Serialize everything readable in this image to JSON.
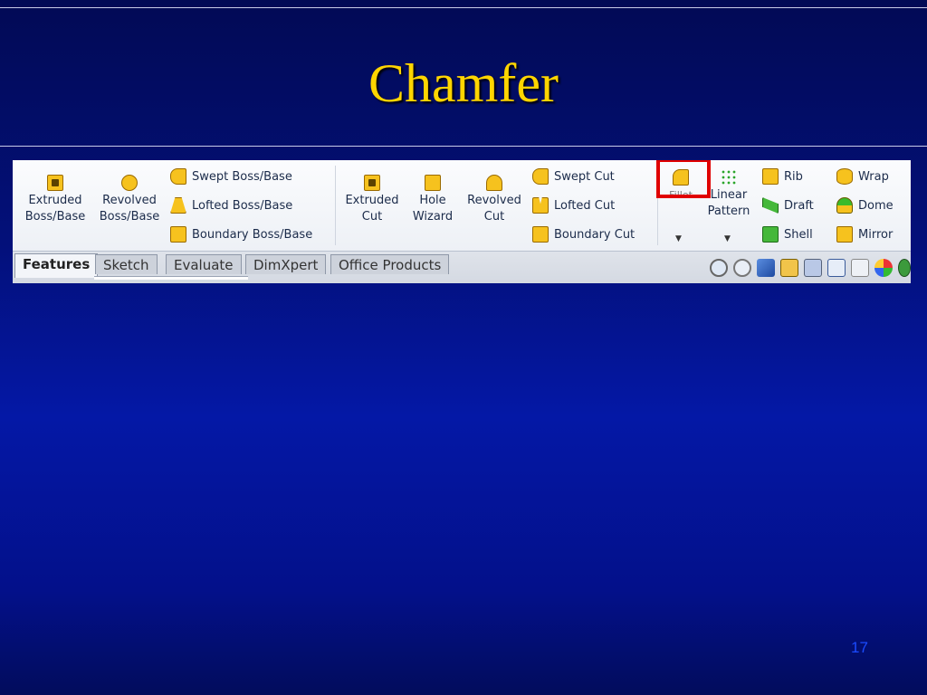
{
  "slide": {
    "title": "Chamfer",
    "page_number": "17",
    "colors": {
      "background": "#0418a6",
      "title": "#ffd500",
      "highlight": "#e00000"
    }
  },
  "ribbon": {
    "commands": {
      "extruded_boss": "Extruded\nBoss/Base",
      "revolved_boss": "Revolved\nBoss/Base",
      "swept_boss": "Swept Boss/Base",
      "lofted_boss": "Lofted Boss/Base",
      "boundary_boss": "Boundary Boss/Base",
      "extruded_cut": "Extruded\nCut",
      "hole_wizard": "Hole\nWizard",
      "revolved_cut": "Revolved\nCut",
      "swept_cut": "Swept Cut",
      "lofted_cut": "Lofted Cut",
      "boundary_cut": "Boundary Cut",
      "fillet": "Fillet",
      "linear_pattern": "Linear\nPattern",
      "rib": "Rib",
      "draft": "Draft",
      "shell": "Shell",
      "wrap": "Wrap",
      "dome": "Dome",
      "mirror": "Mirror"
    },
    "tabs": [
      "Features",
      "Sketch",
      "Evaluate",
      "DimXpert",
      "Office Products"
    ],
    "active_tab": "Features",
    "view_tool_icons": [
      "zoom-to-fit-icon",
      "zoom-to-area-icon",
      "previous-view-icon",
      "section-view-icon",
      "view-orientation-icon",
      "display-style-icon",
      "hide-show-items-icon",
      "edit-appearance-icon",
      "apply-scene-icon"
    ]
  }
}
